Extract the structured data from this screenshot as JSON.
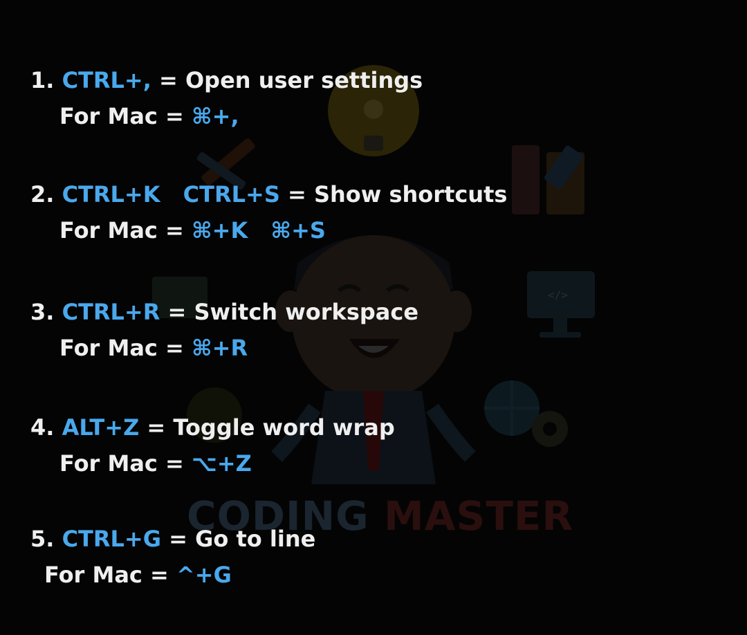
{
  "colors": {
    "background": "#040404",
    "text": "#efefef",
    "accent": "#4aa8ec",
    "watermark_primary": "#1a2530",
    "watermark_secondary": "#2a0f0e"
  },
  "watermark": {
    "part1": "CODING",
    "part2": "MASTER"
  },
  "shortcuts": [
    {
      "number": "1.",
      "keys": [
        "CTRL+,"
      ],
      "action": "Open user settings",
      "mac_label": "For Mac =",
      "mac_keys": [
        "⌘+,"
      ]
    },
    {
      "number": "2.",
      "keys": [
        "CTRL+K",
        "CTRL+S"
      ],
      "action": "Show shortcuts",
      "mac_label": "For Mac =",
      "mac_keys": [
        "⌘+K",
        "⌘+S"
      ]
    },
    {
      "number": "3.",
      "keys": [
        "CTRL+R"
      ],
      "action": "Switch workspace",
      "mac_label": "For Mac =",
      "mac_keys": [
        "⌘+R"
      ]
    },
    {
      "number": "4.",
      "keys": [
        "ALT+Z"
      ],
      "action": "Toggle word wrap",
      "mac_label": "For Mac =",
      "mac_keys": [
        "⌥+Z"
      ]
    },
    {
      "number": "5.",
      "keys": [
        "CTRL+G"
      ],
      "action": "Go to line",
      "mac_label": "For Mac =",
      "mac_keys": [
        "^+G"
      ]
    }
  ],
  "symbols": {
    "equals": "="
  }
}
